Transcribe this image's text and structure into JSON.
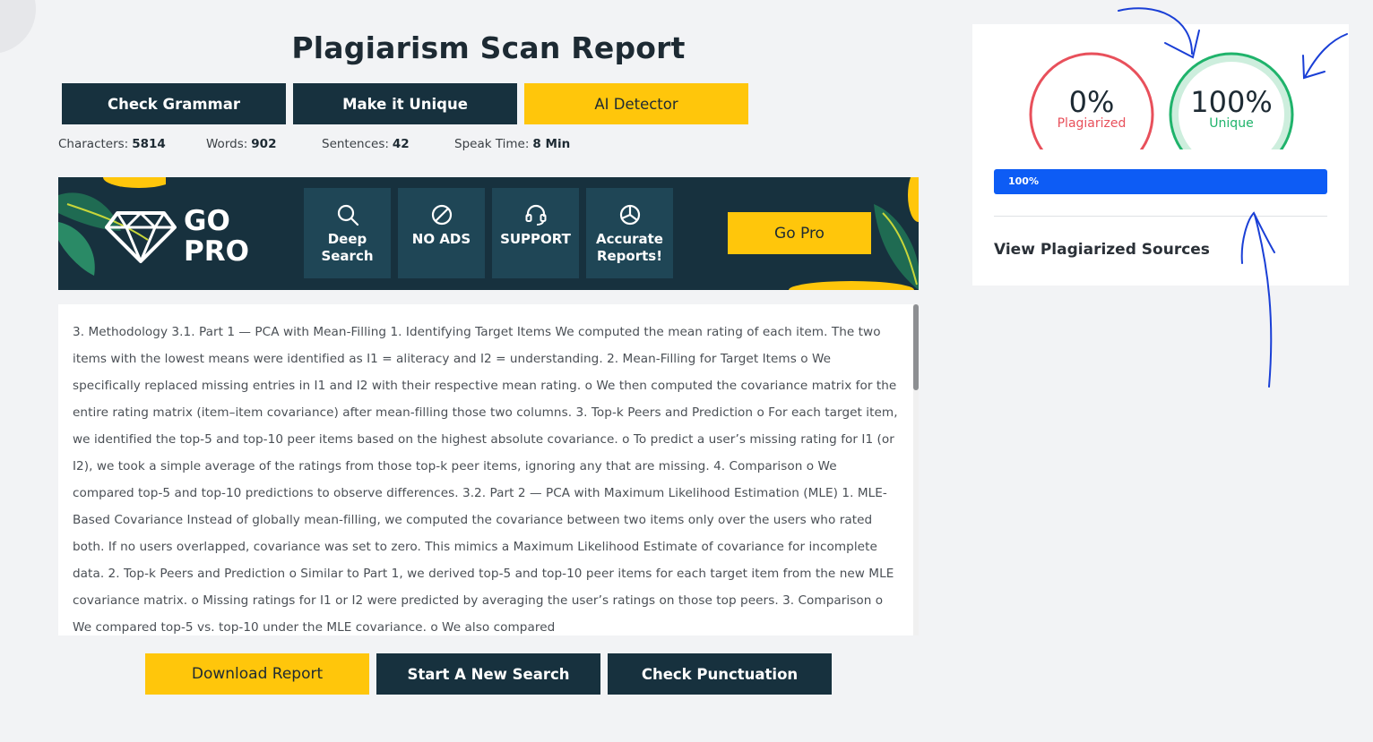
{
  "page": {
    "title": "Plagiarism Scan Report"
  },
  "top_buttons": {
    "check_grammar": "Check Grammar",
    "make_unique": "Make it Unique",
    "ai_detector": "AI Detector"
  },
  "stats": {
    "characters_label": "Characters:",
    "characters_value": "5814",
    "words_label": "Words:",
    "words_value": "902",
    "sentences_label": "Sentences:",
    "sentences_value": "42",
    "speak_label": "Speak Time:",
    "speak_value": "8 Min"
  },
  "gopro": {
    "logo_line1": "GO",
    "logo_line2": "PRO",
    "features": [
      {
        "icon": "search-icon",
        "line1": "Deep",
        "line2": "Search"
      },
      {
        "icon": "no-ads-icon",
        "line1": "NO ADS",
        "line2": ""
      },
      {
        "icon": "headset-icon",
        "line1": "SUPPORT",
        "line2": ""
      },
      {
        "icon": "pie-chart-icon",
        "line1": "Accurate",
        "line2": "Reports!"
      }
    ],
    "button": "Go Pro"
  },
  "document_text": "3. Methodology 3.1. Part 1 — PCA with Mean-Filling 1. Identifying Target Items We computed the mean rating of each item. The two items with the lowest means were identified as I1 = aliteracy and I2 = understanding. 2. Mean-Filling for Target Items o We specifically replaced missing entries in I1 and I2 with their respective mean rating. o We then computed the covariance matrix for the entire rating matrix (item–item covariance) after mean-filling those two columns. 3. Top-k Peers and Prediction o For each target item, we identified the top-5 and top-10 peer items based on the highest absolute covariance. o To predict a user’s missing rating for I1 (or I2), we took a simple average of the ratings from those top-k peer items, ignoring any that are missing. 4. Comparison o We compared top-5 and top-10 predictions to observe differences. 3.2. Part 2 — PCA with Maximum Likelihood Estimation (MLE) 1. MLE-Based Covariance Instead of globally mean-filling, we computed the covariance between two items only over the users who rated both. If no users overlapped, covariance was set to zero. This mimics a Maximum Likelihood Estimate of covariance for incomplete data. 2. Top-k Peers and Prediction o Similar to Part 1, we derived top-5 and top-10 peer items for each target item from the new MLE covariance matrix. o Missing ratings for I1 or I2 were predicted by averaging the user’s ratings on those top peers. 3. Comparison o We compared top-5 vs. top-10 under the MLE covariance. o We also compared",
  "bottom_buttons": {
    "download": "Download Report",
    "new_search": "Start A New Search",
    "punctuation": "Check Punctuation"
  },
  "results": {
    "plagiarized_pct": "0%",
    "plagiarized_label": "Plagiarized",
    "unique_pct": "100%",
    "unique_label": "Unique",
    "progress_text": "100%",
    "progress_value": 1.0,
    "sources_link": "View Plagiarized Sources"
  },
  "colors": {
    "dark": "#17313e",
    "yellow": "#ffc60b",
    "plagiarized_red": "#e8505b",
    "unique_green": "#1fb36b",
    "progress_blue": "#0d5cf5",
    "annotation_blue": "#1a3fd6"
  }
}
